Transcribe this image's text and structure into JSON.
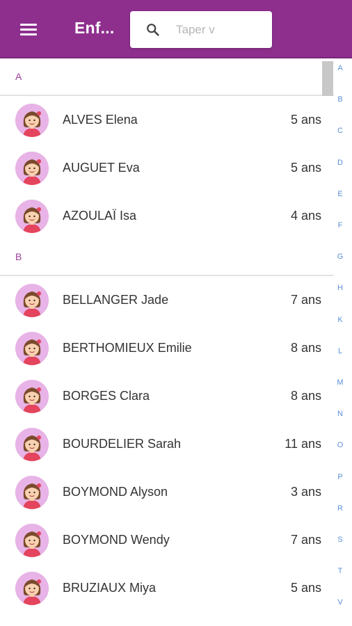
{
  "app_bar": {
    "title": "Enf...",
    "background_color": "#8e2f8e",
    "menu_icon": "hamburger-menu-icon",
    "search": {
      "icon": "search-icon",
      "placeholder": "Taper v",
      "value": ""
    }
  },
  "sections": [
    {
      "letter": "A",
      "children": [
        {
          "name": "ALVES Elena",
          "age": "5 ans",
          "avatar": "girl-avatar-icon"
        },
        {
          "name": "AUGUET Eva",
          "age": "5 ans",
          "avatar": "girl-avatar-icon"
        },
        {
          "name": "AZOULAÏ Isa",
          "age": "4 ans",
          "avatar": "girl-avatar-icon"
        }
      ]
    },
    {
      "letter": "B",
      "children": [
        {
          "name": "BELLANGER Jade",
          "age": "7 ans",
          "avatar": "girl-avatar-icon"
        },
        {
          "name": "BERTHOMIEUX Emilie",
          "age": "8 ans",
          "avatar": "girl-avatar-icon"
        },
        {
          "name": "BORGES Clara",
          "age": "8 ans",
          "avatar": "girl-avatar-icon"
        },
        {
          "name": "BOURDELIER Sarah",
          "age": "11 ans",
          "avatar": "girl-avatar-icon"
        },
        {
          "name": "BOYMOND Alyson",
          "age": "3 ans",
          "avatar": "girl-avatar-icon"
        },
        {
          "name": "BOYMOND Wendy",
          "age": "7 ans",
          "avatar": "girl-avatar-icon"
        },
        {
          "name": "BRUZIAUX Miya",
          "age": "5 ans",
          "avatar": "girl-avatar-icon"
        }
      ]
    }
  ],
  "alphabet_index": [
    "A",
    "B",
    "C",
    "D",
    "E",
    "F",
    "G",
    "H",
    "K",
    "L",
    "M",
    "N",
    "O",
    "P",
    "R",
    "S",
    "T",
    "V"
  ],
  "colors": {
    "section_letter": "#9b3e9b",
    "index_letter": "#5a8fd8",
    "avatar_background": "#e8b3e6"
  }
}
